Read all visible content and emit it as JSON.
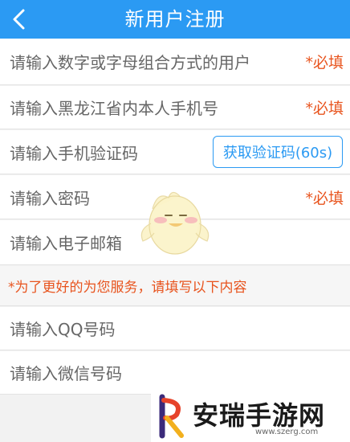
{
  "header": {
    "title": "新用户注册"
  },
  "form": {
    "username_placeholder": "请输入数字或字母组合方式的用户",
    "username_required": "*必填",
    "phone_placeholder": "请输入黑龙江省内本人手机号",
    "phone_required": "*必填",
    "code_placeholder": "请输入手机验证码",
    "code_button": "获取验证码(60s)",
    "password_placeholder": "请输入密码",
    "password_required": "*必填",
    "email_placeholder": "请输入电子邮箱",
    "notice": "*为了更好的为您服务，请填写以下内容",
    "qq_placeholder": "请输入QQ号码",
    "wechat_placeholder": "请输入微信号码"
  },
  "watermark": {
    "brand": "安瑞手游网",
    "url": "www.szerg.com"
  },
  "colors": {
    "accent": "#2b9af3",
    "required": "#e8541e"
  },
  "icons": {
    "back": "chevron-left-icon"
  }
}
